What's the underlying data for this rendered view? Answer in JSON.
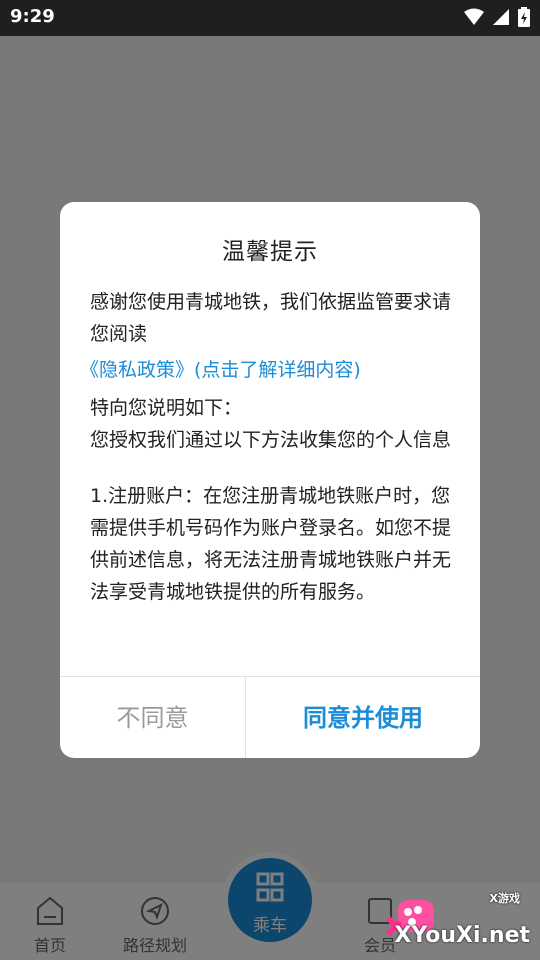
{
  "status_bar": {
    "time": "9:29"
  },
  "tabbar": {
    "items": [
      {
        "label": "首页",
        "icon": "home-icon"
      },
      {
        "label": "路径规划",
        "icon": "navigation-icon"
      },
      {
        "label": "会员",
        "icon": "member-icon"
      }
    ],
    "ride_label": "乘车"
  },
  "dialog": {
    "title": "温馨提示",
    "intro": "感谢您使用青城地铁，我们依据监管要求请您阅读",
    "policy_link": "《隐私政策》(点击了解详细内容)",
    "line2": "特向您说明如下：",
    "line3": "您授权我们通过以下方法收集您的个人信息",
    "item1": " 1.注册账户：在您注册青城地铁账户时，您需提供手机号码作为账户登录名。如您不提供前述信息，将无法注册青城地铁账户并无法享受青城地铁提供的所有服务。",
    "disagree_label": "不同意",
    "agree_label": "同意并使用"
  },
  "watermark": {
    "brand": "XYouXi.net",
    "tag": "X游戏"
  }
}
